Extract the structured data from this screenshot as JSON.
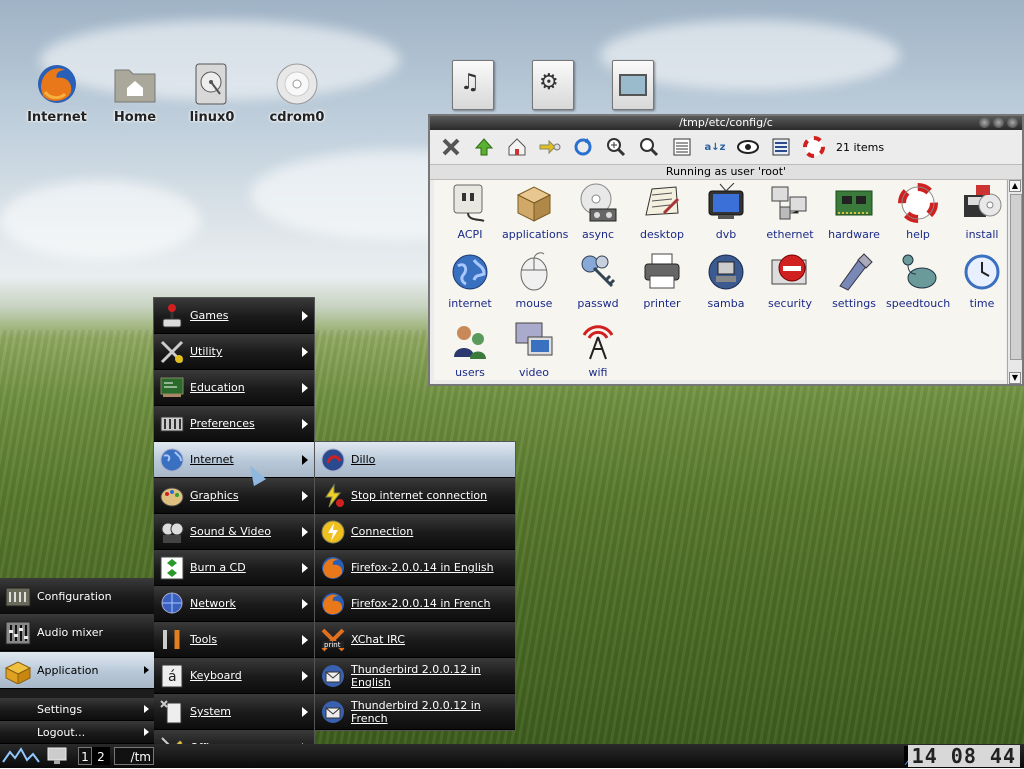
{
  "desktop": {
    "icons": [
      {
        "label": "Internet",
        "icon": "firefox-icon"
      },
      {
        "label": "Home",
        "icon": "home-folder-icon"
      },
      {
        "label": "linux0",
        "icon": "hard-disk-icon"
      },
      {
        "label": "cdrom0",
        "icon": "cdrom-icon"
      }
    ],
    "file_icons": [
      "audio-file-icon",
      "video-file-icon",
      "image-file-icon"
    ]
  },
  "file_manager": {
    "title": "/tmp/etc/config/c",
    "item_count": "21 items",
    "status": "Running as user 'root'",
    "toolbar": [
      "close-icon",
      "up-arrow-icon",
      "home-icon",
      "go-icon",
      "refresh-icon",
      "zoom-in-icon",
      "zoom-fit-icon",
      "details-icon",
      "sort-icon",
      "eye-icon",
      "list-icon",
      "help-lifebuoy-icon"
    ],
    "items": [
      {
        "label": "ACPI",
        "icon": "plug-icon"
      },
      {
        "label": "applications",
        "icon": "box-icon"
      },
      {
        "label": "async",
        "icon": "cd-tape-icon"
      },
      {
        "label": "desktop",
        "icon": "desktop-icon"
      },
      {
        "label": "dvb",
        "icon": "tv-icon"
      },
      {
        "label": "ethernet",
        "icon": "network-computers-icon"
      },
      {
        "label": "hardware",
        "icon": "circuit-board-icon"
      },
      {
        "label": "help",
        "icon": "lifebuoy-icon"
      },
      {
        "label": "install",
        "icon": "install-disk-icon"
      },
      {
        "label": "internet",
        "icon": "globe-icon"
      },
      {
        "label": "mouse",
        "icon": "mouse-icon"
      },
      {
        "label": "passwd",
        "icon": "keys-icon"
      },
      {
        "label": "printer",
        "icon": "printer-icon"
      },
      {
        "label": "samba",
        "icon": "samba-icon"
      },
      {
        "label": "security",
        "icon": "no-entry-icon"
      },
      {
        "label": "settings",
        "icon": "tools-icon"
      },
      {
        "label": "speedtouch",
        "icon": "modem-icon"
      },
      {
        "label": "time",
        "icon": "clock-icon"
      },
      {
        "label": "users",
        "icon": "users-icon"
      },
      {
        "label": "video",
        "icon": "video-display-icon"
      },
      {
        "label": "wifi",
        "icon": "wifi-antenna-icon"
      }
    ]
  },
  "app_menu": {
    "items": [
      {
        "label": "Games",
        "icon": "joystick-icon"
      },
      {
        "label": "Utility",
        "icon": "utility-tools-icon"
      },
      {
        "label": "Education",
        "icon": "blackboard-icon"
      },
      {
        "label": "Preferences",
        "icon": "preferences-icon"
      },
      {
        "label": "Internet",
        "icon": "globe-icon"
      },
      {
        "label": "Graphics",
        "icon": "palette-icon"
      },
      {
        "label": "Sound & Video",
        "icon": "film-icon"
      },
      {
        "label": "Burn a CD",
        "icon": "burn-cd-icon"
      },
      {
        "label": "Network",
        "icon": "network-globe-icon"
      },
      {
        "label": "Tools",
        "icon": "wrench-icon"
      },
      {
        "label": "Keyboard",
        "icon": "keyboard-icon"
      },
      {
        "label": "System",
        "icon": "system-icon"
      },
      {
        "label": "Office",
        "icon": "pen-icon"
      }
    ],
    "selected_index": 4
  },
  "internet_submenu": {
    "items": [
      {
        "label": "Dillo",
        "icon": "dillo-icon"
      },
      {
        "label": "Stop internet connection",
        "icon": "stop-connection-icon"
      },
      {
        "label": "Connection",
        "icon": "lightning-icon"
      },
      {
        "label": "Firefox-2.0.0.14 in English",
        "icon": "firefox-icon"
      },
      {
        "label": "Firefox-2.0.0.14 in French",
        "icon": "firefox-icon"
      },
      {
        "label": "XChat IRC",
        "icon": "xchat-icon"
      },
      {
        "label": "Thunderbird 2.0.0.12 in English",
        "icon": "thunderbird-icon"
      },
      {
        "label": "Thunderbird 2.0.0.12 in French",
        "icon": "thunderbird-icon"
      }
    ],
    "selected_index": 0
  },
  "left_menu": {
    "items": [
      {
        "label": "Configuration",
        "icon": "configuration-icon"
      },
      {
        "label": "Audio mixer",
        "icon": "mixer-icon"
      },
      {
        "label": "Application",
        "icon": "application-box-icon"
      },
      {
        "label": "Settings"
      },
      {
        "label": "Logout..."
      }
    ]
  },
  "taskbar": {
    "workspaces": [
      "1",
      "2"
    ],
    "task_label": "/tm",
    "clock": "14 08 44"
  },
  "colors": {
    "menu_bg": "#1c1c1c",
    "menu_selected": "#b8c8d8",
    "file_label": "#1a2a88"
  }
}
